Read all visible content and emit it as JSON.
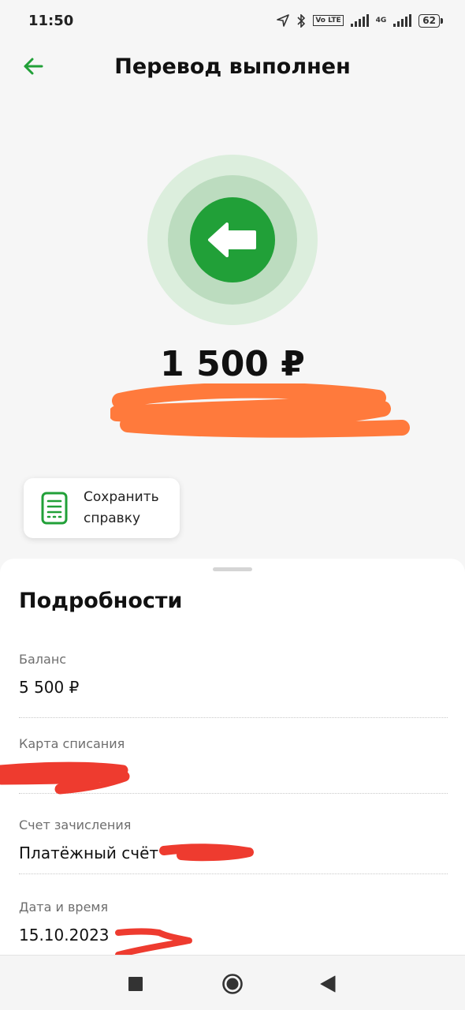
{
  "status_bar": {
    "time": "11:50",
    "network": "4G",
    "volte": "Vo LTE",
    "battery": "62"
  },
  "header": {
    "title": "Перевод выполнен",
    "back_icon": "arrow-left-icon"
  },
  "transfer": {
    "amount": "1 500 ₽",
    "icon": "transfer-arrow-icon",
    "accent_color": "#21a038"
  },
  "save_receipt": {
    "label": "Сохранить\nсправку",
    "icon": "receipt-icon"
  },
  "details": {
    "title": "Подробности",
    "rows": [
      {
        "label": "Баланс",
        "value": "5 500 ₽"
      },
      {
        "label": "Карта списания",
        "value": ""
      },
      {
        "label": "Счет зачисления",
        "value": "Платёжный счёт"
      },
      {
        "label": "Дата и время",
        "value": "15.10.2023"
      }
    ]
  },
  "nav_bar": {
    "recents_icon": "square-icon",
    "home_icon": "circle-home-icon",
    "back_icon": "triangle-back-icon"
  }
}
